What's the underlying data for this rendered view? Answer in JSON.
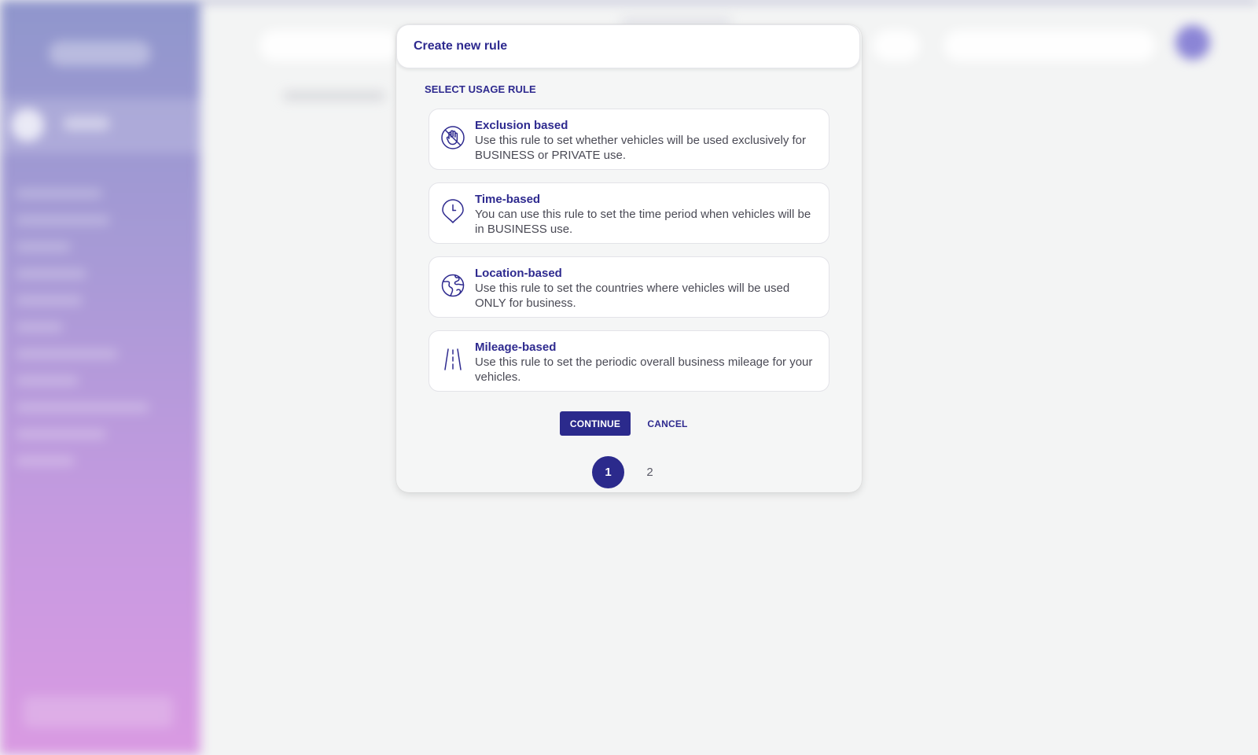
{
  "modal": {
    "title": "Create new rule",
    "section_label": "SELECT USAGE RULE",
    "rules": [
      {
        "icon": "stop-hand-icon",
        "title": "Exclusion based",
        "description": "Use this rule to set whether vehicles will be used exclusively for BUSINESS or PRIVATE use."
      },
      {
        "icon": "clock-pin-icon",
        "title": "Time-based",
        "description": "You can use this rule to set the time period when vehicles will be in BUSINESS use."
      },
      {
        "icon": "globe-icon",
        "title": "Location-based",
        "description": "Use this rule to set the countries where vehicles will be used ONLY for business."
      },
      {
        "icon": "road-icon",
        "title": "Mileage-based",
        "description": "Use this rule to set the periodic overall business mileage for your vehicles."
      }
    ],
    "continue_label": "CONTINUE",
    "cancel_label": "CANCEL",
    "steps": [
      "1",
      "2"
    ],
    "active_step": "1"
  },
  "colors": {
    "accent": "#2b2a8c",
    "text_primary": "#2e2a8f",
    "text_secondary": "#4a4a55",
    "sidebar_gradient_top": "#8f96cc",
    "sidebar_gradient_bottom": "#d99ae2"
  }
}
